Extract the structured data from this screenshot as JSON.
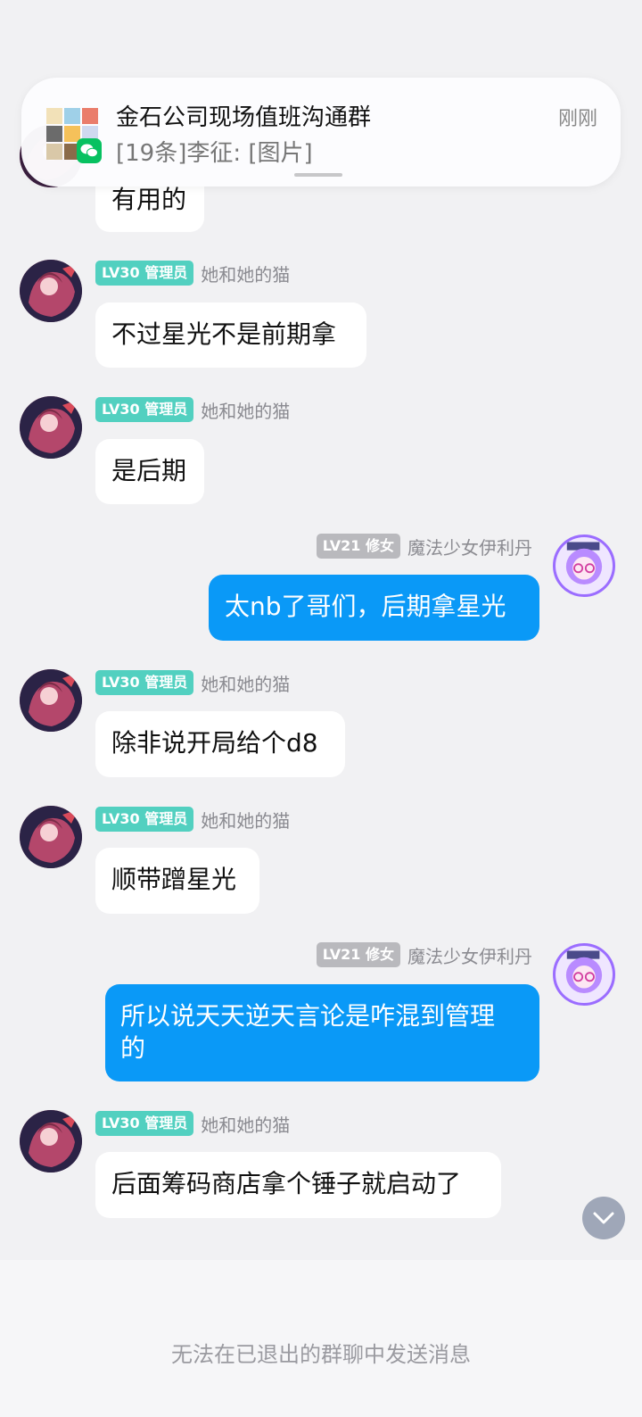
{
  "notification": {
    "title": "金石公司现场值班沟通群",
    "subtitle": "[19条]李征: [图片]",
    "time": "刚刚",
    "app_icon": "wechat-icon",
    "accent": "#07c160"
  },
  "messages": [
    {
      "side": "left",
      "text": "有用的"
    },
    {
      "side": "left",
      "level": "LV30",
      "role": "管理员",
      "name": "她和她的猫",
      "text": "不过星光不是前期拿"
    },
    {
      "side": "left",
      "level": "LV30",
      "role": "管理员",
      "name": "她和她的猫",
      "text": "是后期"
    },
    {
      "side": "right",
      "level": "LV21",
      "role": "修女",
      "name": "魔法少女伊利丹",
      "text": "太nb了哥们，后期拿星光"
    },
    {
      "side": "left",
      "level": "LV30",
      "role": "管理员",
      "name": "她和她的猫",
      "text": "除非说开局给个d8"
    },
    {
      "side": "left",
      "level": "LV30",
      "role": "管理员",
      "name": "她和她的猫",
      "text": "顺带蹭星光"
    },
    {
      "side": "right",
      "level": "LV21",
      "role": "修女",
      "name": "魔法少女伊利丹",
      "text_line1": "所以说天天逆天言论是咋混到管理",
      "text_line2": "的"
    },
    {
      "side": "left",
      "level": "LV30",
      "role": "管理员",
      "name": "她和她的猫",
      "text": "后面筹码商店拿个锤子就启动了"
    }
  ],
  "footer": {
    "notice": "无法在已退出的群聊中发送消息"
  },
  "colors": {
    "admin_badge": "#52d0c0",
    "nun_badge": "#b9b9bd",
    "outgoing_bubble": "#0a99f7",
    "incoming_bubble": "#ffffff",
    "background": "#f1f1f3"
  }
}
